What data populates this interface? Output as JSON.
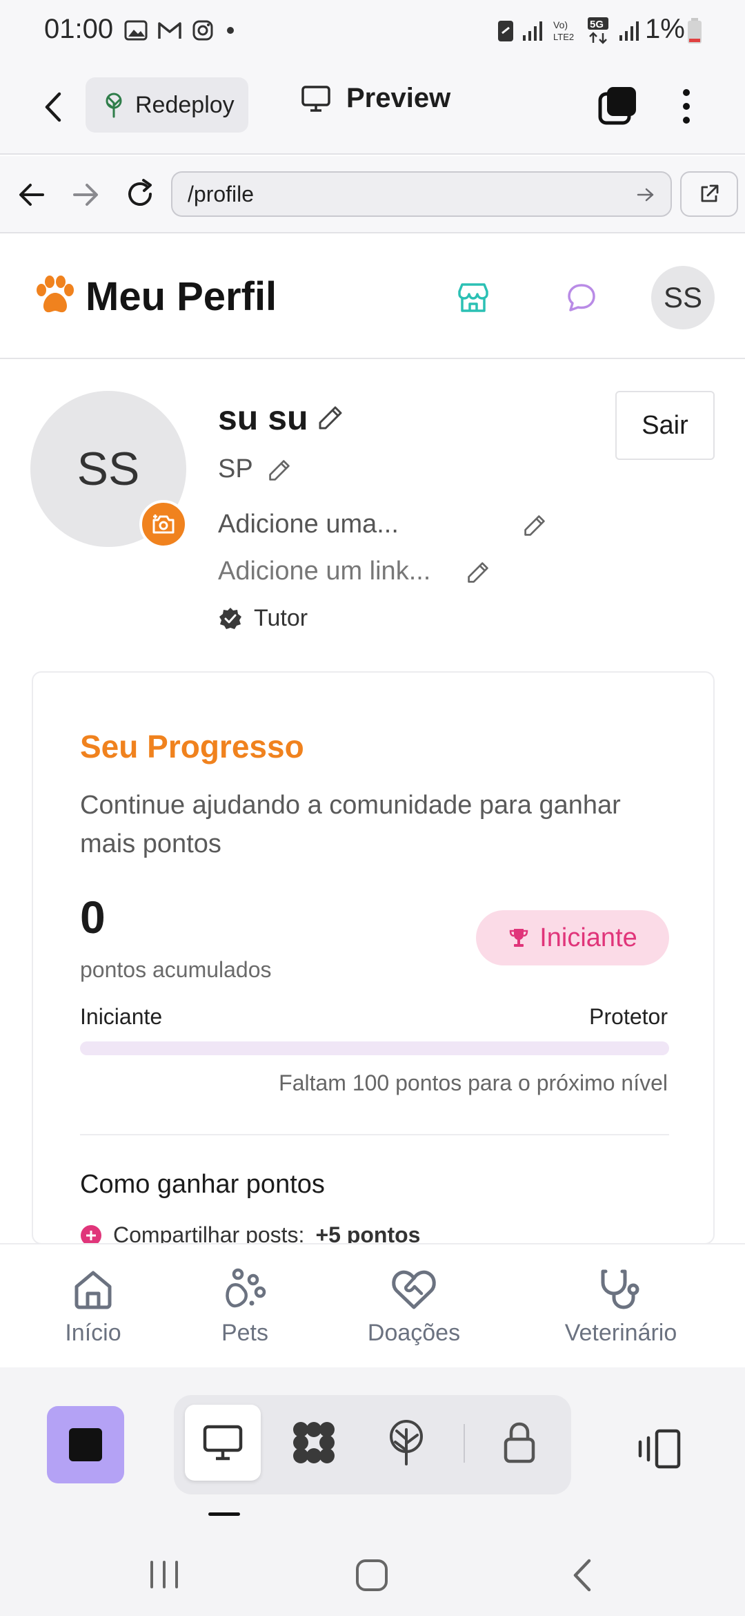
{
  "status_bar": {
    "time": "01:00",
    "battery": "1%"
  },
  "app_toolbar": {
    "redeploy_label": "Redeploy",
    "preview_label": "Preview"
  },
  "url_bar": {
    "url": "/profile"
  },
  "header": {
    "title": "Meu Perfil",
    "avatar_initials": "SS"
  },
  "profile": {
    "avatar_initials": "SS",
    "name": "su su",
    "location": "SP",
    "bio_placeholder": "Adicione uma...",
    "link_placeholder": "Adicione um link...",
    "role": "Tutor",
    "logout_label": "Sair"
  },
  "progress": {
    "title": "Seu Progresso",
    "subtitle": "Continue ajudando a comunidade para ganhar mais pontos",
    "points": "0",
    "points_label": "pontos acumulados",
    "level_badge": "Iniciante",
    "current_level": "Iniciante",
    "next_level": "Protetor",
    "progress_fraction": 0,
    "next_level_text": "Faltam 100 pontos para o próximo nível",
    "how_to_title": "Como ganhar pontos",
    "how_to_items": [
      {
        "label": "Compartilhar posts:",
        "value": "+5 pontos"
      }
    ]
  },
  "bottom_nav": {
    "items": [
      {
        "label": "Início",
        "icon": "home-icon"
      },
      {
        "label": "Pets",
        "icon": "paw-icon"
      },
      {
        "label": "Doações",
        "icon": "heart-handshake-icon"
      },
      {
        "label": "Veterinário",
        "icon": "stethoscope-icon"
      }
    ]
  },
  "colors": {
    "accent_orange": "#f0821e",
    "badge_pink": "#e0357a",
    "badge_bg": "#fbdbe7",
    "stop_button": "#b4a2f5",
    "store_icon": "#2bc0b4",
    "chat_icon": "#b98be6"
  }
}
